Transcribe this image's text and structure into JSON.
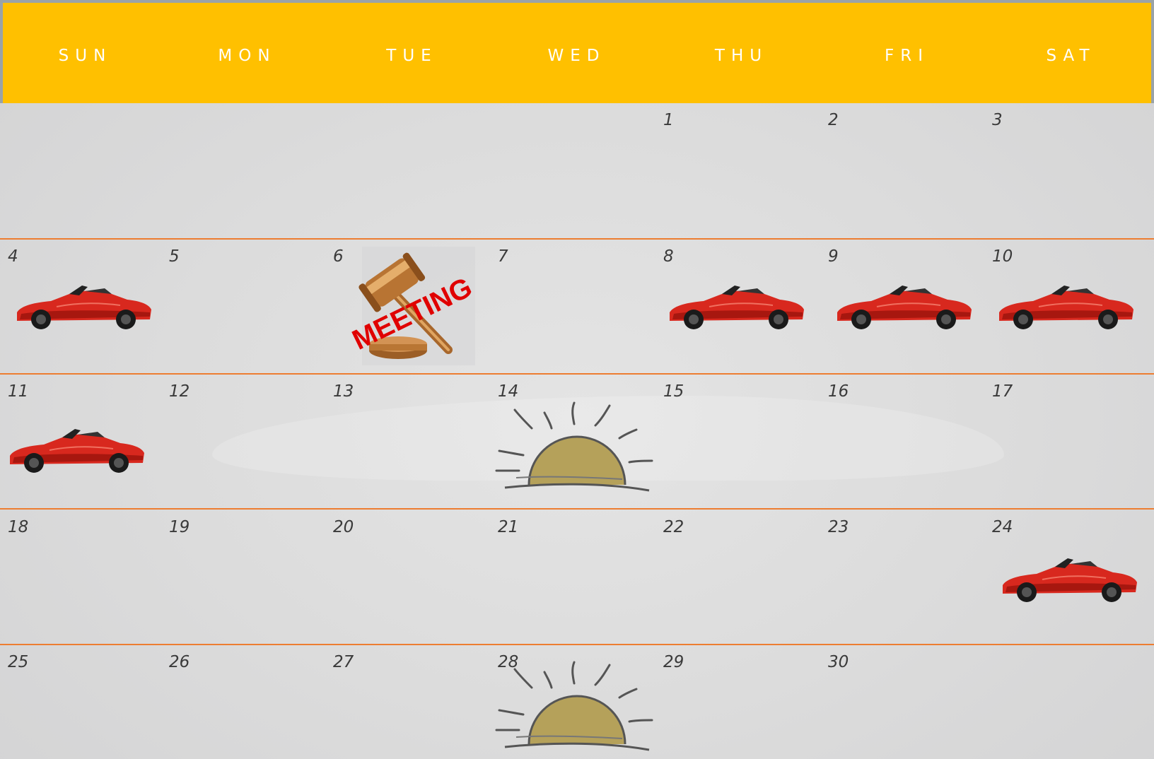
{
  "weekdays": [
    "SUN",
    "MON",
    "TUE",
    "WED",
    "THU",
    "FRI",
    "SAT"
  ],
  "weeks": [
    [
      null,
      null,
      null,
      null,
      "1",
      "2",
      "3"
    ],
    [
      "4",
      "5",
      "6",
      "7",
      "8",
      "9",
      "10"
    ],
    [
      "11",
      "12",
      "13",
      "14",
      "15",
      "16",
      "17"
    ],
    [
      "18",
      "19",
      "20",
      "21",
      "22",
      "23",
      "24"
    ],
    [
      "25",
      "26",
      "27",
      "28",
      "29",
      "30",
      null
    ]
  ],
  "events": {
    "meeting_label": "MEETING",
    "car_days": [
      "4",
      "8",
      "9",
      "10",
      "11",
      "24"
    ],
    "meeting_days": [
      "6"
    ],
    "sun_days": [
      "14",
      "28"
    ]
  },
  "colors": {
    "header": "#ffc000",
    "divider": "#ed7d31",
    "car": "#d8281e",
    "sun": "#b5a15a"
  },
  "icons": [
    "car-icon",
    "gavel-icon",
    "sun-icon"
  ]
}
